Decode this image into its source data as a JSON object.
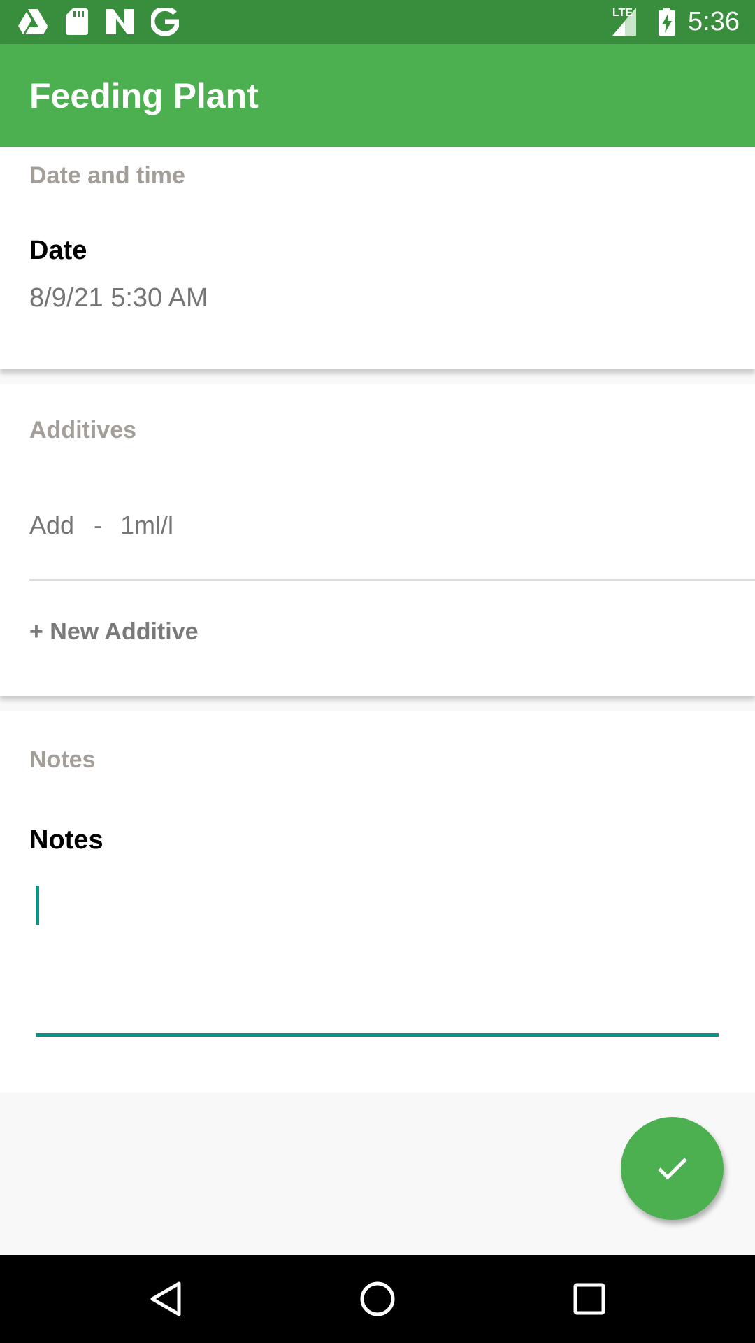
{
  "status_bar": {
    "time": "5:36",
    "network_label": "LTE",
    "icons": [
      "drive-icon",
      "sd-card-icon",
      "n-icon",
      "google-icon",
      "signal-icon",
      "battery-charging-icon"
    ]
  },
  "app_bar": {
    "title": "Feeding Plant"
  },
  "date_section": {
    "header": "Date and time",
    "label": "Date",
    "value": "8/9/21 5:30 AM"
  },
  "additives_section": {
    "header": "Additives",
    "items": [
      {
        "name": "Add",
        "separator": "-",
        "amount": "1ml/l"
      }
    ],
    "new_button": "+ New Additive"
  },
  "notes_section": {
    "header": "Notes",
    "label": "Notes",
    "value": ""
  },
  "fab": {
    "icon": "checkmark-icon"
  },
  "nav_bar": {
    "icons": [
      "back-icon",
      "home-icon",
      "recents-icon"
    ]
  },
  "colors": {
    "status_bar": "#388e3c",
    "app_bar": "#4caf50",
    "accent": "#009688",
    "section_header": "#a39e98"
  }
}
